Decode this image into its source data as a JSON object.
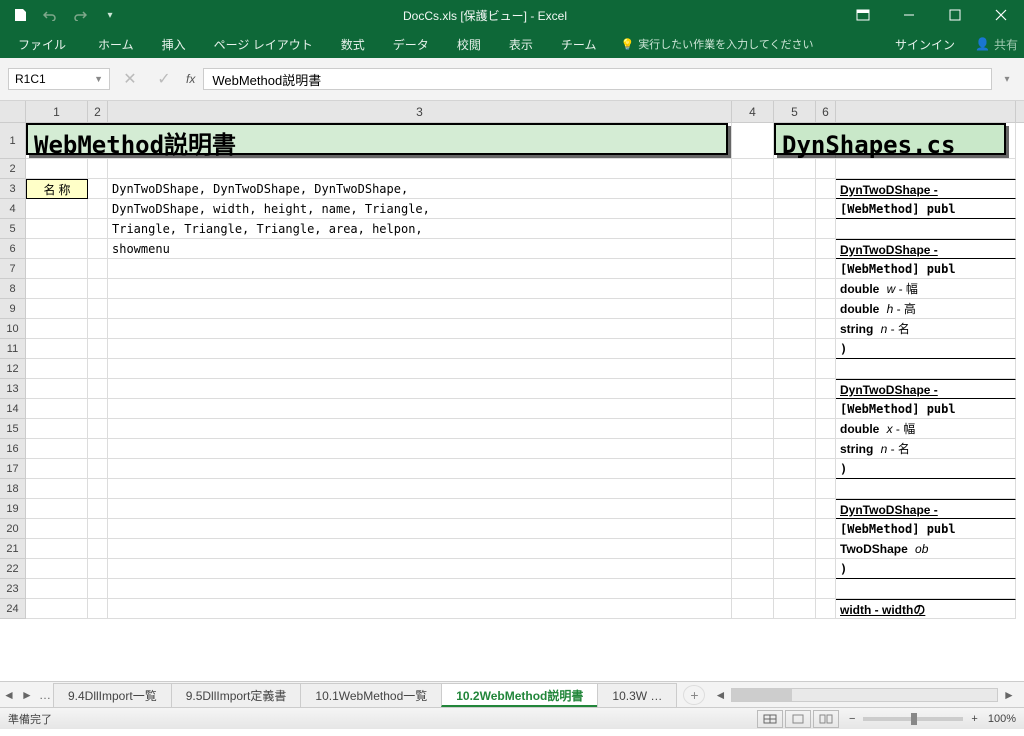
{
  "title": "DocCs.xls  [保護ビュー] - Excel",
  "ribbon": {
    "file": "ファイル",
    "tabs": [
      "ホーム",
      "挿入",
      "ページ レイアウト",
      "数式",
      "データ",
      "校閲",
      "表示",
      "チーム"
    ],
    "tellme": "実行したい作業を入力してください",
    "signin": "サインイン",
    "share": "共有"
  },
  "namebox": "R1C1",
  "formula": "WebMethod説明書",
  "cols": {
    "c1": "1",
    "c2": "2",
    "c3": "3",
    "c4": "4",
    "c5": "5",
    "c6": "6"
  },
  "rows": [
    "1",
    "2",
    "3",
    "4",
    "5",
    "6",
    "7",
    "8",
    "9",
    "10",
    "11",
    "12",
    "13",
    "14",
    "15",
    "16",
    "17",
    "18",
    "19",
    "20",
    "21",
    "22",
    "23",
    "24"
  ],
  "header_left": "WebMethod説明書",
  "header_right": "DynShapes.cs",
  "label_name": "名 称",
  "desc": {
    "r3": "DynTwoDShape, DynTwoDShape, DynTwoDShape,",
    "r4": "DynTwoDShape, width, height, name, Triangle,",
    "r5": "Triangle, Triangle, Triangle, area, helpon,",
    "r6": "showmenu"
  },
  "right": {
    "b1a": "DynTwoDShape - ",
    "b1b": "[WebMethod] publ",
    "b2a": "DynTwoDShape - ",
    "b2b": "[WebMethod] publ",
    "b2c": "  double",
    "b2c_i": "w",
    "b2c_t": "  - 幅",
    "b2d": "  double",
    "b2d_i": "h",
    "b2d_t": "  - 高",
    "b2e": "  string",
    "b2e_i": "n",
    "b2e_t": "  - 名",
    "b2f": ")",
    "b3a": "DynTwoDShape - ",
    "b3b": "[WebMethod] publ",
    "b3c": "  double",
    "b3c_i": "x",
    "b3c_t": "  - 幅",
    "b3d": "  string",
    "b3d_i": "n",
    "b3d_t": "  - 名",
    "b3e": ")",
    "b4a": "DynTwoDShape - ",
    "b4b": "[WebMethod] publ",
    "b4c": "  TwoDShape",
    "b4c_i": "ob",
    "b4d": ")",
    "b5a": "width - widthの"
  },
  "tabs": {
    "t1": "9.4DllImport一覧",
    "t2": "9.5DllImport定義書",
    "t3": "10.1WebMethod一覧",
    "t4": "10.2WebMethod説明書",
    "t5": "10.3W …"
  },
  "status": {
    "ready": "準備完了",
    "zoom": "100%"
  }
}
